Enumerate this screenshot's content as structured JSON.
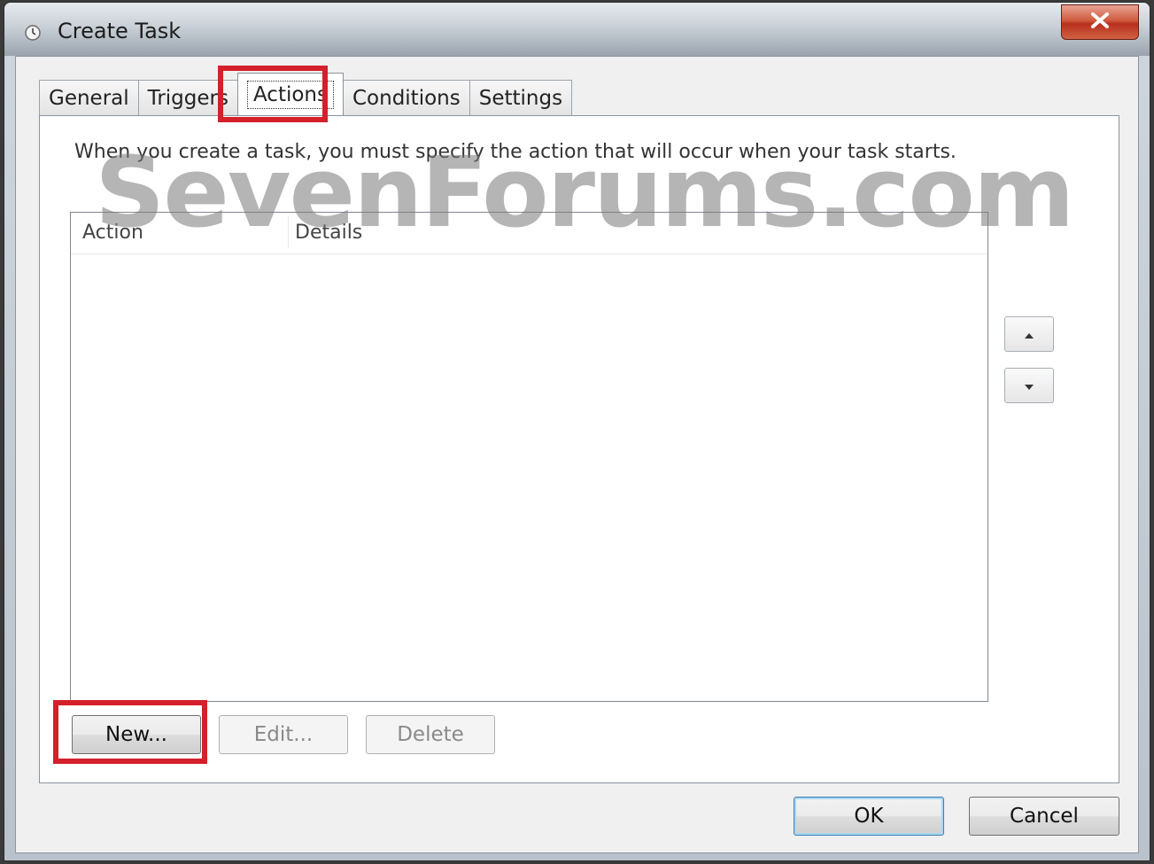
{
  "window": {
    "title": "Create Task",
    "close_label": "X"
  },
  "tabs": [
    {
      "label": "General",
      "active": false
    },
    {
      "label": "Triggers",
      "active": false
    },
    {
      "label": "Actions",
      "active": true
    },
    {
      "label": "Conditions",
      "active": false
    },
    {
      "label": "Settings",
      "active": false
    }
  ],
  "actions_panel": {
    "description": "When you create a task, you must specify the action that will occur when your task starts.",
    "columns": [
      "Action",
      "Details"
    ],
    "rows": [],
    "new_label": "New...",
    "edit_label": "Edit...",
    "delete_label": "Delete"
  },
  "footer": {
    "ok_label": "OK",
    "cancel_label": "Cancel"
  },
  "watermark": "SevenForums.com",
  "colors": {
    "highlight": "#d4202a",
    "close_button": "#c9452b",
    "panel_background": "#ffffff",
    "dialog_background": "#f0f0f0"
  },
  "icons": {
    "title": "clock-icon",
    "close": "close-icon",
    "move_up": "up-arrow-icon",
    "move_down": "down-arrow-icon"
  }
}
